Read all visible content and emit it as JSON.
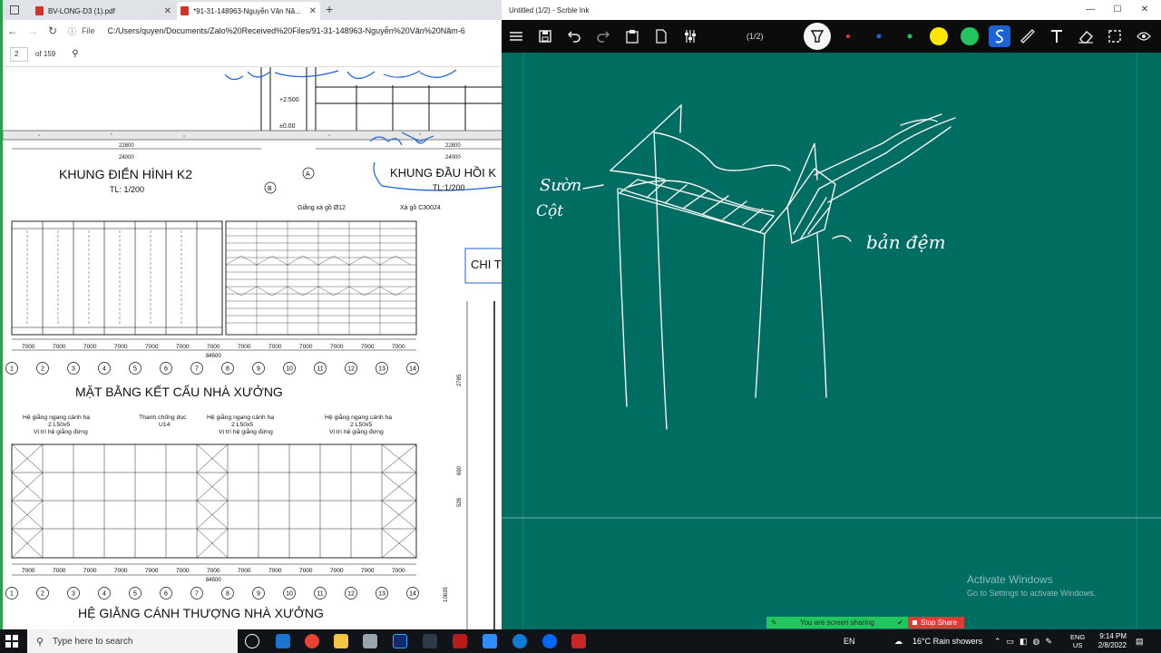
{
  "browser": {
    "tabs": [
      {
        "label": "BV-LONG-D3 (1).pdf"
      },
      {
        "label": "*91-31-148963-Nguyễn Văn Nă..."
      }
    ],
    "address": {
      "file_label": "File",
      "url": "C:/Users/quyen/Documents/Zalo%20Received%20Files/91-31-148963-Nguyễn%20Văn%20Năm-6"
    },
    "pdf": {
      "page": "2",
      "of_pages": "of 159"
    },
    "drawing": {
      "title_k2": "KHUNG ĐIỂN HÌNH K2",
      "scale_k2": "TL: 1/200",
      "title_dau_hoi": "KHUNG ĐẦU HỒI K",
      "scale_dau_hoi": "TL:1/200",
      "chi_t": "CHI T",
      "grid_a": "A",
      "grid_b": "B",
      "dim_22800": "22800",
      "dim_24000": "24000",
      "lvl_2500": "+2.500",
      "lvl_000": "±0.00",
      "giang_xa_go": "Giằng xà gồ Ø12",
      "xa_go": "Xà gồ C30024",
      "plan_title": "MẶT BẰNG KẾT CẤU NHÀ XƯỞNG",
      "bracing_title": "HỆ GIẰNG CÁNH THƯỢNG NHÀ XƯỞNG",
      "he_giang_ngang": "Hệ giằng ngang cánh hạ",
      "angle": "2 L50x5",
      "vi_tri": "Vị trí hệ giằng đứng",
      "thanh_chong": "Thanh chống dọc",
      "u14": "U14",
      "span": "7000",
      "total": "84500",
      "axis_numbers": [
        "1",
        "2",
        "3",
        "4",
        "5",
        "6",
        "7",
        "8",
        "9",
        "10",
        "11",
        "12",
        "13",
        "14"
      ],
      "side_dims": [
        "2785",
        "690",
        "526",
        "10635"
      ]
    }
  },
  "ink": {
    "window_title": "Untitled (1/2) - Scrble Ink",
    "page_indicator": "(1/2)",
    "handwriting": {
      "left_note_1": "Sườn",
      "left_note_2": "Cột",
      "right_note": "bản đệm"
    },
    "activate_title": "Activate Windows",
    "activate_sub": "Go to Settings to activate Windows.",
    "sharing_text": "You are screen sharing",
    "stop_share": "Stop Share",
    "colors": {
      "background": "#006d62",
      "yellow": "#ffe600",
      "green": "#22c55e",
      "red": "#e53935",
      "blue": "#1e63d6"
    }
  },
  "taskbar": {
    "search_placeholder": "Type here to search",
    "language": "EN",
    "weather": "16°C  Rain showers",
    "ime_1": "ENG",
    "ime_2": "US",
    "time": "9:14 PM",
    "date": "2/8/2022"
  }
}
